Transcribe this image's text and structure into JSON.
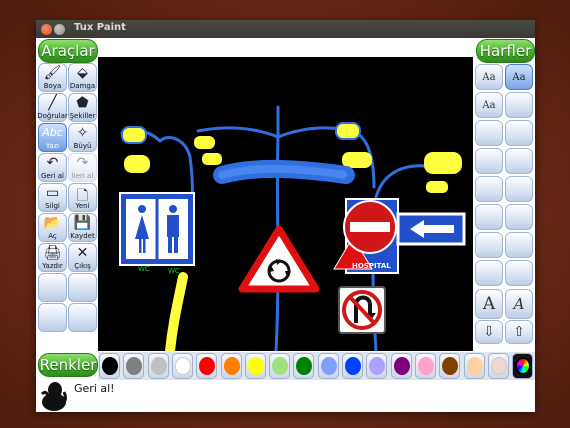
{
  "window": {
    "title": "Tux Paint"
  },
  "left_panel": {
    "header": "Araçlar",
    "tools": [
      {
        "label": "Boya",
        "icon": "brush-icon",
        "glyph": "🖌"
      },
      {
        "label": "Damga",
        "icon": "stamp-icon",
        "glyph": "⬙"
      },
      {
        "label": "Doğrular",
        "icon": "lines-icon",
        "glyph": "╱"
      },
      {
        "label": "Şekiller",
        "icon": "shapes-icon",
        "glyph": "⬟"
      },
      {
        "label": "Yazı",
        "icon": "text-icon",
        "glyph": "Abc"
      },
      {
        "label": "Büyü",
        "icon": "magic-wand-icon",
        "glyph": "✧"
      },
      {
        "label": "Geri al",
        "icon": "undo-icon",
        "glyph": "↶"
      },
      {
        "label": "İleri al",
        "icon": "redo-icon",
        "glyph": "↷"
      },
      {
        "label": "Silgi",
        "icon": "eraser-icon",
        "glyph": "▭"
      },
      {
        "label": "Yeni",
        "icon": "new-page-icon",
        "glyph": "🗋"
      },
      {
        "label": "Aç",
        "icon": "open-icon",
        "glyph": "📂"
      },
      {
        "label": "Kaydet",
        "icon": "save-icon",
        "glyph": "💾"
      },
      {
        "label": "Yazdır",
        "icon": "print-icon",
        "glyph": "🖨"
      },
      {
        "label": "Çıkış",
        "icon": "quit-icon",
        "glyph": "✕"
      }
    ]
  },
  "right_panel": {
    "header": "Harfler",
    "font_sample": "Aa",
    "size_up_glyph": "A",
    "size_down_glyph": "A"
  },
  "colors": {
    "header": "Renkler",
    "palette": [
      "#000000",
      "#808080",
      "#c0c0c0",
      "#ffffff",
      "#ff0000",
      "#ff8000",
      "#ffff00",
      "#a0e080",
      "#008000",
      "#80a0ff",
      "#0040ff",
      "#b0a0ff",
      "#800080",
      "#ffa0c8",
      "#804000",
      "#ffd0a0",
      "#f0d8d0",
      "#rainbow"
    ]
  },
  "canvas": {
    "toilet_sign_label": "WC",
    "toilet_sign_label2": "WC",
    "hospital_label": "HOSPITAL"
  },
  "status": {
    "message": "Geri al!"
  }
}
